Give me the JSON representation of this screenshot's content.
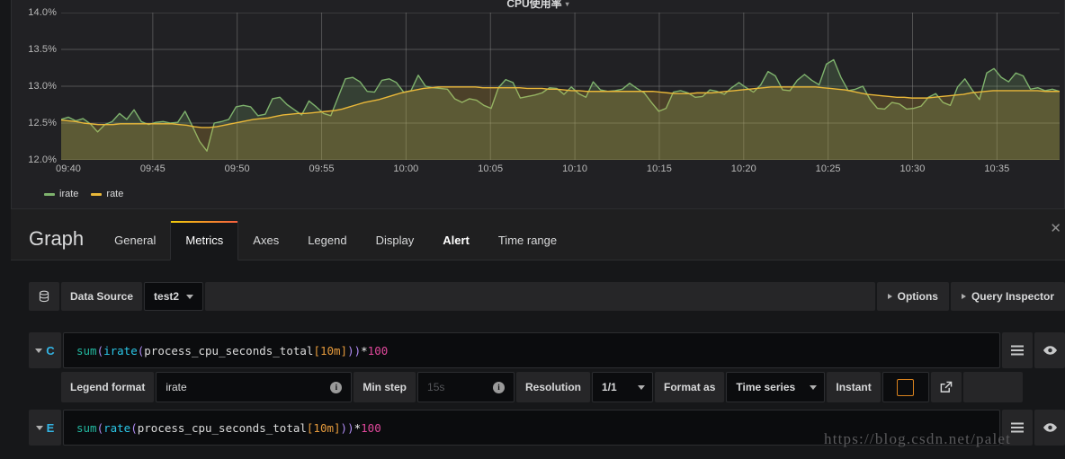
{
  "panel": {
    "title": "CPU使用率",
    "caret": "▾"
  },
  "chart_data": {
    "type": "area",
    "title": "CPU使用率",
    "xlabel": "",
    "ylabel": "",
    "ylim": [
      12.0,
      14.0
    ],
    "y_tick_labels": [
      "14.0%",
      "13.5%",
      "13.0%",
      "12.5%",
      "12.0%"
    ],
    "y_tick_values": [
      14.0,
      13.5,
      13.0,
      12.5,
      12.0
    ],
    "x_tick_labels": [
      "09:40",
      "09:45",
      "09:50",
      "09:55",
      "10:00",
      "10:05",
      "10:10",
      "10:15",
      "10:20",
      "10:25",
      "10:30",
      "10:35"
    ],
    "grid": true,
    "legend_position": "bottom-left",
    "series": [
      {
        "name": "irate",
        "color": "#7eb26d",
        "fill": true,
        "values": [
          12.55,
          12.58,
          12.53,
          12.56,
          12.49,
          12.38,
          12.48,
          12.52,
          12.63,
          12.55,
          12.68,
          12.52,
          12.48,
          12.51,
          12.52,
          12.5,
          12.51,
          12.66,
          12.46,
          12.25,
          12.12,
          12.5,
          12.52,
          12.55,
          12.72,
          12.74,
          12.72,
          12.6,
          12.62,
          12.83,
          12.85,
          12.75,
          12.68,
          12.61,
          12.8,
          12.72,
          12.63,
          12.6,
          12.85,
          13.1,
          13.12,
          13.06,
          12.93,
          12.92,
          13.08,
          13.1,
          13.05,
          12.92,
          12.94,
          13.15,
          13.0,
          12.98,
          12.97,
          12.96,
          12.83,
          12.78,
          12.83,
          12.81,
          12.74,
          12.7,
          12.98,
          13.09,
          13.05,
          12.84,
          12.86,
          12.88,
          12.91,
          12.98,
          12.97,
          12.89,
          12.99,
          12.9,
          12.85,
          13.06,
          12.95,
          12.93,
          12.94,
          12.96,
          13.04,
          12.97,
          12.91,
          12.78,
          12.66,
          12.7,
          12.92,
          12.94,
          12.91,
          12.85,
          12.86,
          12.95,
          12.93,
          12.89,
          12.98,
          13.05,
          12.98,
          12.92,
          13.02,
          13.2,
          13.14,
          12.95,
          12.94,
          13.08,
          13.16,
          13.08,
          13.02,
          13.3,
          13.36,
          13.12,
          12.94,
          12.96,
          13.0,
          12.82,
          12.7,
          12.69,
          12.78,
          12.76,
          12.69,
          12.7,
          12.73,
          12.85,
          12.9,
          12.78,
          12.74,
          12.99,
          13.1,
          12.95,
          12.82,
          13.18,
          13.24,
          13.12,
          13.06,
          13.18,
          13.14,
          12.96,
          12.98,
          12.94,
          12.96,
          12.93
        ]
      },
      {
        "name": "rate",
        "color": "#eab839",
        "fill": true,
        "values": [
          12.54,
          12.53,
          12.52,
          12.5,
          12.49,
          12.48,
          12.48,
          12.48,
          12.49,
          12.49,
          12.49,
          12.49,
          12.49,
          12.49,
          12.49,
          12.49,
          12.48,
          12.47,
          12.45,
          12.44,
          12.44,
          12.45,
          12.47,
          12.49,
          12.51,
          12.53,
          12.55,
          12.56,
          12.57,
          12.59,
          12.61,
          12.62,
          12.63,
          12.63,
          12.64,
          12.65,
          12.66,
          12.67,
          12.69,
          12.72,
          12.75,
          12.78,
          12.8,
          12.82,
          12.85,
          12.88,
          12.91,
          12.93,
          12.95,
          12.97,
          12.98,
          12.99,
          12.99,
          12.99,
          12.99,
          12.99,
          12.99,
          12.98,
          12.98,
          12.98,
          12.98,
          12.98,
          12.98,
          12.97,
          12.97,
          12.97,
          12.96,
          12.96,
          12.95,
          12.94,
          12.94,
          12.93,
          12.93,
          12.93,
          12.93,
          12.93,
          12.93,
          12.93,
          12.93,
          12.93,
          12.93,
          12.92,
          12.91,
          12.9,
          12.9,
          12.9,
          12.91,
          12.91,
          12.91,
          12.92,
          12.93,
          12.94,
          12.95,
          12.96,
          12.97,
          12.98,
          12.99,
          12.99,
          12.99,
          12.99,
          12.99,
          12.99,
          12.99,
          12.98,
          12.97,
          12.96,
          12.95,
          12.93,
          12.91,
          12.89,
          12.88,
          12.87,
          12.86,
          12.85,
          12.85,
          12.84,
          12.84,
          12.84,
          12.85,
          12.86,
          12.87,
          12.88,
          12.89,
          12.91,
          12.92,
          12.93,
          12.94,
          12.94,
          12.94,
          12.94,
          12.94,
          12.94,
          12.94,
          12.93,
          12.93,
          12.93
        ]
      }
    ]
  },
  "editor": {
    "title": "Graph",
    "tabs": [
      {
        "label": "General",
        "active": false,
        "strong": false
      },
      {
        "label": "Metrics",
        "active": true,
        "strong": false
      },
      {
        "label": "Axes",
        "active": false,
        "strong": false
      },
      {
        "label": "Legend",
        "active": false,
        "strong": false
      },
      {
        "label": "Display",
        "active": false,
        "strong": false
      },
      {
        "label": "Alert",
        "active": false,
        "strong": true
      },
      {
        "label": "Time range",
        "active": false,
        "strong": false
      }
    ],
    "close_label": "✕"
  },
  "datasource": {
    "icon": "database-icon",
    "label": "Data Source",
    "value": "test2",
    "caret": "▾",
    "options_label": "Options",
    "query_inspector_label": "Query Inspector"
  },
  "queries": [
    {
      "letter": "C",
      "collapse_caret": "▾",
      "expr": {
        "func_outer": "sum",
        "p1": "(",
        "func_inner": "irate",
        "p2": "(",
        "metric": "process_cpu_seconds_total",
        "range": "[10m]",
        "p3": ")",
        "p4": ")",
        "op": "*",
        "num": "100"
      },
      "options": {
        "legend_format_label": "Legend format",
        "legend_format_value": "irate",
        "min_step_label": "Min step",
        "min_step_placeholder": "15s",
        "resolution_label": "Resolution",
        "resolution_value": "1/1",
        "format_as_label": "Format as",
        "format_as_value": "Time series",
        "instant_label": "Instant",
        "instant_checked": false
      }
    },
    {
      "letter": "E",
      "collapse_caret": "▾",
      "expr": {
        "func_outer": "sum",
        "p1": "(",
        "func_inner": "rate",
        "p2": "(",
        "metric": "process_cpu_seconds_total",
        "range": "[10m]",
        "p3": ")",
        "p4": ")",
        "op": "*",
        "num": "100"
      }
    }
  ],
  "watermark": "https://blog.csdn.net/palet",
  "colors": {
    "irate": "#7eb26d",
    "rate": "#eab839",
    "accent_start": "#f2cc0c",
    "accent_end": "#f55f3e",
    "query_letter": "#33b5e5",
    "panel_bg": "#212124",
    "page_bg": "#161719"
  }
}
